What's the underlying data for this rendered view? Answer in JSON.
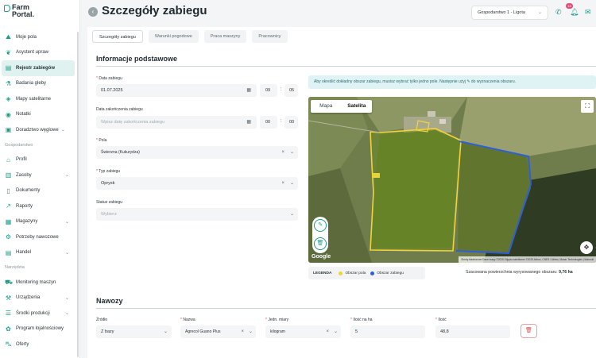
{
  "app": {
    "logo_line1": "Farm",
    "logo_line2": "Portal."
  },
  "sidebar": {
    "items": [
      {
        "label": "Moje pola",
        "icon": "map-fields-icon"
      },
      {
        "label": "Asystent upraw",
        "icon": "leaf-icon"
      },
      {
        "label": "Rejestr zabiegów",
        "icon": "clipboard-icon",
        "active": true
      },
      {
        "label": "Badania gleby",
        "icon": "flask-icon"
      },
      {
        "label": "Mapy satelitarne",
        "icon": "satellite-icon"
      },
      {
        "label": "Notatki",
        "icon": "eye-icon"
      },
      {
        "label": "Doradztwo węglowe",
        "icon": "document-icon",
        "chevron": true
      }
    ],
    "section_farm": "Gospodarstwo",
    "farm_items": [
      {
        "label": "Profil",
        "icon": "home-icon"
      },
      {
        "label": "Zasoby",
        "icon": "bar-chart-icon",
        "chevron": true
      },
      {
        "label": "Dokumenty",
        "icon": "file-icon"
      },
      {
        "label": "Raporty",
        "icon": "trend-icon"
      },
      {
        "label": "Magazyny",
        "icon": "warehouse-icon",
        "chevron": true
      },
      {
        "label": "Potrzeby nawozowe",
        "icon": "gear-icon"
      },
      {
        "label": "Handel",
        "icon": "shop-icon",
        "chevron": true
      }
    ],
    "section_tools": "Narzędzia",
    "tool_items": [
      {
        "label": "Monitoring maszyn",
        "icon": "car-icon"
      },
      {
        "label": "Urządzenia",
        "icon": "device-icon",
        "chevron": true
      },
      {
        "label": "Środki produkcji",
        "icon": "database-icon",
        "chevron": true
      },
      {
        "label": "Program lojalnościowy",
        "icon": "leaves-icon"
      },
      {
        "label": "Oferty",
        "icon": "cart-icon"
      }
    ]
  },
  "header": {
    "title": "Szczegóły zabiegu",
    "farm_select": "Gospodarstwo 1 - Ligota",
    "notification_count": "13"
  },
  "tabs": [
    "Szczegóły zabiegu",
    "Warunki pogodowe",
    "Praca maszyny",
    "Pracownicy"
  ],
  "basic_info": {
    "title": "Informacje podstawowe",
    "date_label": "Data zabiegu",
    "date_value": "01.07.2025",
    "hour": "09",
    "minute": "05",
    "end_date_label": "Data zakończenia zabiegu",
    "end_date_placeholder": "Wpisz datę zakończenia zabiegu",
    "end_hour": "00",
    "end_minute": "00",
    "field_label": "Pola",
    "field_value": "Świerzna (Kukurydza)",
    "type_label": "Typ zabiegu",
    "type_value": "Oprysk",
    "status_label": "Status zabiegu",
    "status_placeholder": "Wybierz",
    "time_separator": ":"
  },
  "map": {
    "info_text": "Aby określić dokładny obszar zabiegu, musisz wybrać tylko jedno pole. Następnie użyj ✎ do wyznaczenia obszaru.",
    "toggle_map": "Mapa",
    "toggle_satellite": "Satelita",
    "google": "Google",
    "attribution": "Skróty klawiszowe   Dane mapy ©2025 Zdjęcia satelitarne ©2025 Airbus, CNES / Airbus, Maxar Technologies | Warunki",
    "legend_title": "LEGENDA",
    "legend_field": "Obszar pola",
    "legend_treatment": "Obszar zabiegu",
    "area_label": "Szacowana powierzchnia wyrysowanego obszaru:",
    "area_value": "9,76 ha",
    "colors": {
      "field": "#f2d43a",
      "treatment": "#2f5fd6"
    }
  },
  "fertilizers": {
    "title": "Nawozy",
    "source_label": "Źródło",
    "source_value": "Z bazy",
    "name_label": "Nazwa",
    "name_value": "Agrecol Guano Plus",
    "unit_label": "Jedn. miary",
    "unit_value": "kilogram",
    "per_ha_label": "Ilość na ha",
    "per_ha_value": "5",
    "amount_label": "Ilość",
    "amount_value": "48,8"
  },
  "colors": {
    "accent": "#1e9c8a",
    "danger": "#e04848"
  }
}
